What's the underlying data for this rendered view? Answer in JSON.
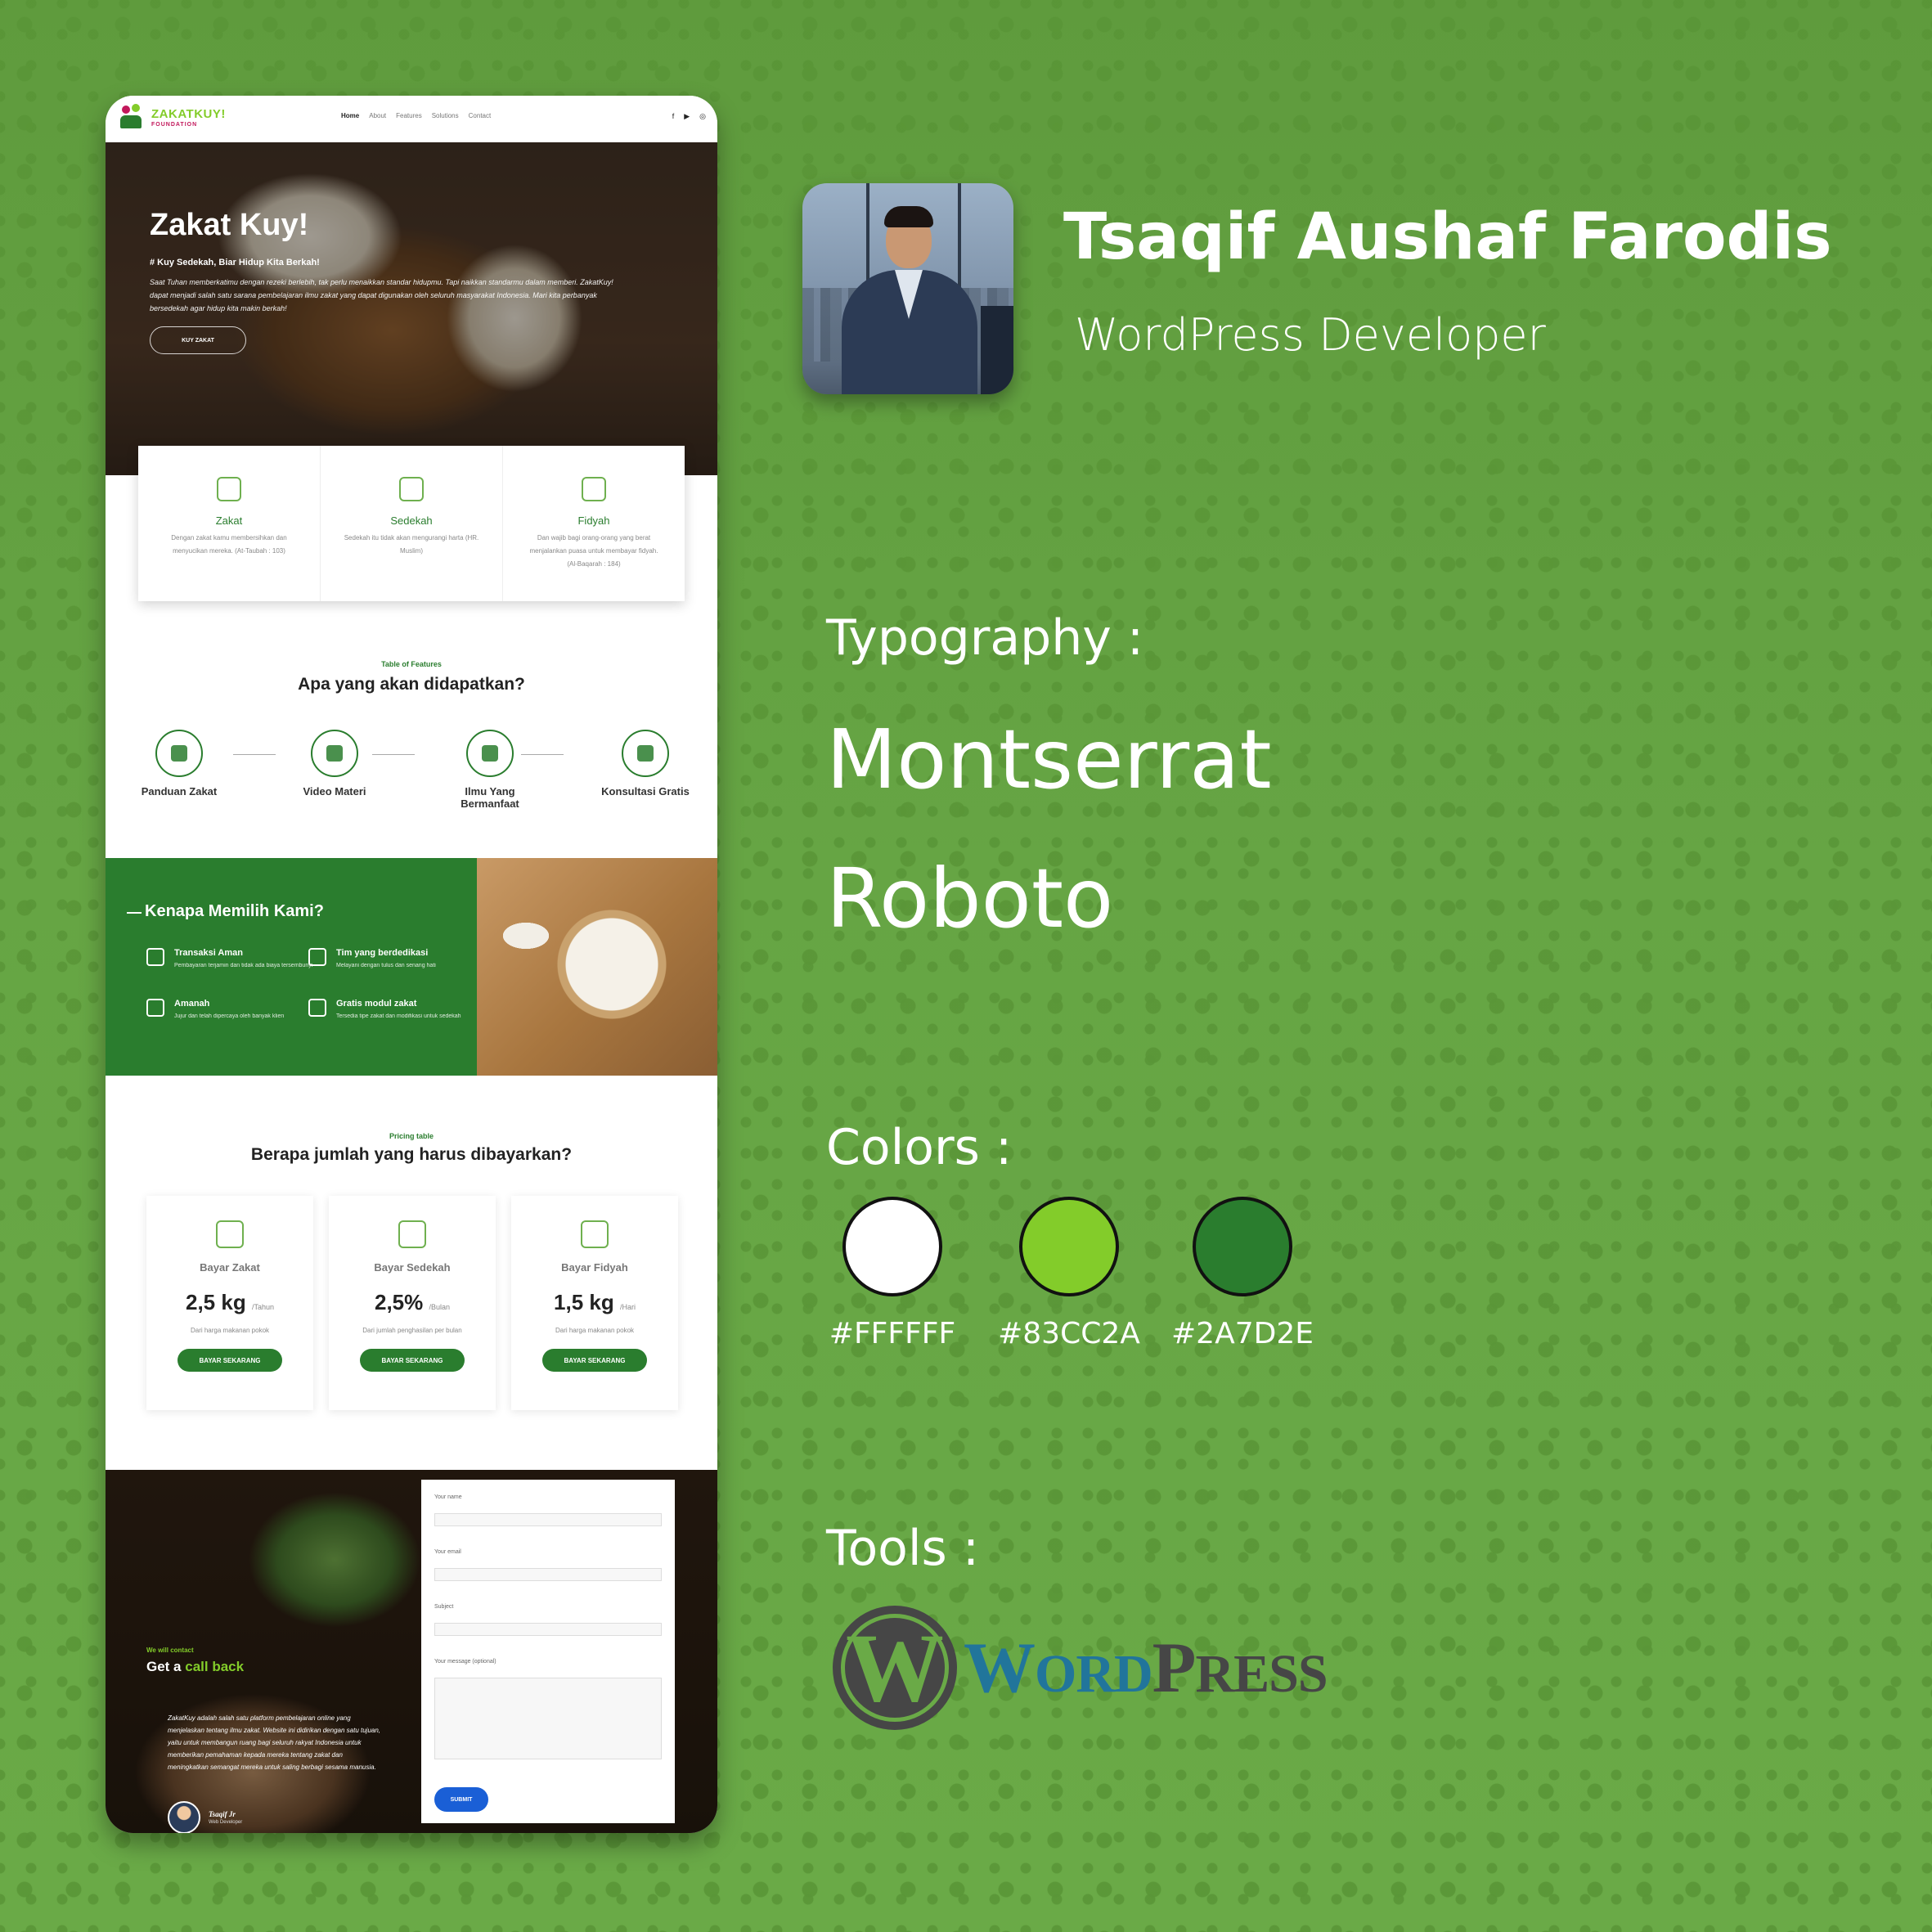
{
  "profile": {
    "name": "Tsaqif Aushaf Farodis",
    "role": "WordPress Developer"
  },
  "typography": {
    "label": "Typography :",
    "fonts": [
      "Montserrat",
      "Roboto"
    ]
  },
  "colors": {
    "label": "Colors :",
    "swatches": [
      {
        "hex": "#FFFFFF",
        "label": "#FFFFFF"
      },
      {
        "hex": "#83CC2A",
        "label": "#83CC2A"
      },
      {
        "hex": "#2A7D2E",
        "label": "#2A7D2E"
      }
    ]
  },
  "tools": {
    "label": "Tools :",
    "wordpress_logo_text": "WordPress"
  },
  "site": {
    "logo_name": "ZAKATKUY!",
    "logo_sub": "FOUNDATION",
    "menu": [
      "Home",
      "About",
      "Features",
      "Solutions",
      "Contact"
    ],
    "social_icons": [
      "facebook-icon",
      "youtube-icon",
      "instagram-icon"
    ],
    "hero": {
      "title": "Zakat Kuy!",
      "subtitle": "# Kuy Sedekah, Biar Hidup Kita Berkah!",
      "paragraph": "Saat Tuhan memberkatimu dengan rezeki berlebih, tak perlu menaikkan standar hidupmu. Tapi naikkan standarmu dalam memberi. ZakatKuy! dapat menjadi salah satu sarana pembelajaran ilmu zakat yang dapat digunakan oleh seluruh masyarakat Indonesia. Mari kita perbanyak bersedekah agar hidup kita makin berkah!",
      "button": "KUY ZAKAT"
    },
    "cards": [
      {
        "title": "Zakat",
        "desc": "Dengan zakat kamu membersihkan dan menyucikan mereka. (At-Taubah : 103)"
      },
      {
        "title": "Sedekah",
        "desc": "Sedekah itu tidak akan mengurangi harta (HR. Muslim)"
      },
      {
        "title": "Fidyah",
        "desc": "Dan wajib bagi orang-orang yang berat menjalankan puasa untuk membayar fidyah. (Al-Baqarah : 184)"
      }
    ],
    "features": {
      "label": "Table of Features",
      "title": "Apa yang akan didapatkan?",
      "items": [
        "Panduan Zakat",
        "Video Materi",
        "Ilmu Yang Bermanfaat",
        "Konsultasi Gratis"
      ]
    },
    "why": {
      "title": "Kenapa Memilih Kami?",
      "items": [
        {
          "title": "Transaksi Aman",
          "desc": "Pembayaran terjamin dan tidak ada biaya tersembunyi"
        },
        {
          "title": "Tim yang berdedikasi",
          "desc": "Melayani dengan tulus dan senang hati"
        },
        {
          "title": "Amanah",
          "desc": "Jujur dan telah dipercaya oleh banyak klien"
        },
        {
          "title": "Gratis modul zakat",
          "desc": "Tersedia tipe zakat dan modifikasi untuk sedekah"
        }
      ]
    },
    "pricing": {
      "label": "Pricing table",
      "title": "Berapa jumlah yang harus dibayarkan?",
      "plans": [
        {
          "name": "Bayar Zakat",
          "amount": "2,5 kg",
          "unit": "/Tahun",
          "desc": "Dari harga makanan pokok",
          "button": "BAYAR SEKARANG"
        },
        {
          "name": "Bayar Sedekah",
          "amount": "2,5%",
          "unit": "/Bulan",
          "desc": "Dari jumlah penghasilan per bulan",
          "button": "BAYAR SEKARANG"
        },
        {
          "name": "Bayar Fidyah",
          "amount": "1,5 kg",
          "unit": "/Hari",
          "desc": "Dari harga makanan pokok",
          "button": "BAYAR SEKARANG"
        }
      ]
    },
    "contact": {
      "small_label": "We will contact",
      "title_prefix": "Get a ",
      "title_highlight": "call back",
      "paragraph": "ZakatKuy adalah salah satu platform pembelajaran online yang menjelaskan tentang ilmu zakat. Website ini didirikan dengan satu tujuan, yaitu untuk membangun ruang bagi seluruh rakyat Indonesia untuk memberikan pemahaman kepada mereka tentang zakat dan meningkatkan semangat mereka untuk saling berbagi sesama manusia.",
      "author_name": "Tsaqif Jr",
      "author_role": "Web Developer",
      "form": {
        "name_label": "Your name",
        "email_label": "Your email",
        "subject_label": "Subject",
        "message_label": "Your message (optional)",
        "submit": "SUBMIT"
      }
    }
  }
}
